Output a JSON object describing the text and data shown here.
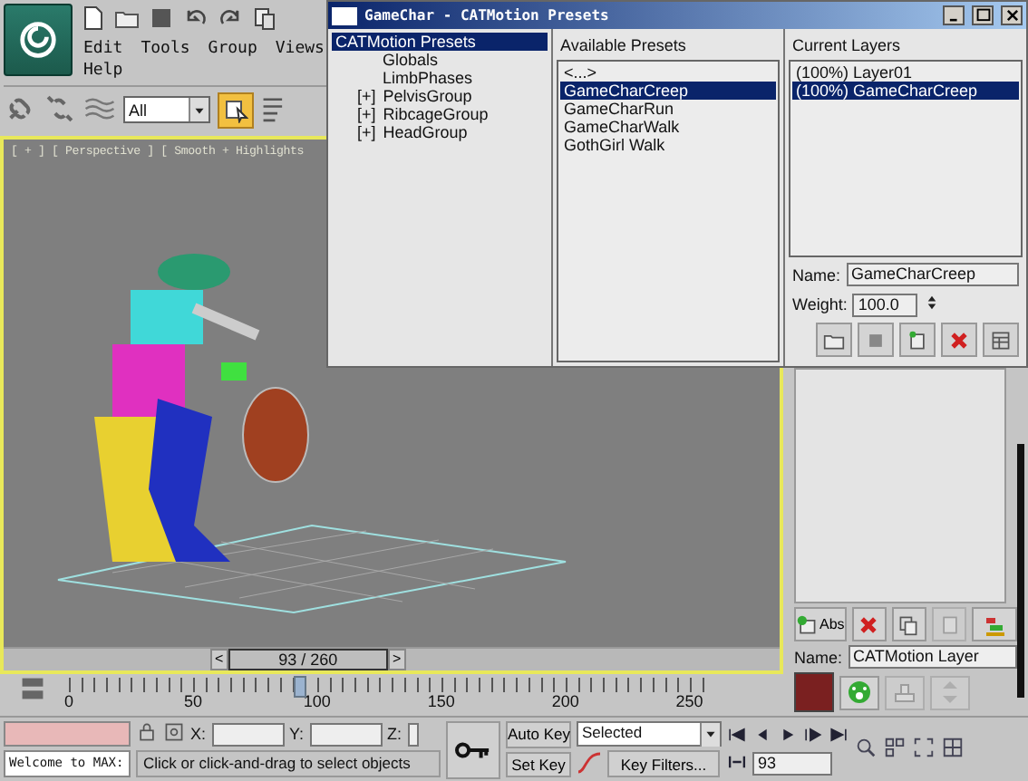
{
  "app": {
    "menus": [
      {
        "label": "Edit"
      },
      {
        "label": "Tools"
      },
      {
        "label": "Group"
      },
      {
        "label": "Views"
      },
      {
        "label": "Help"
      }
    ],
    "filter": "All"
  },
  "viewport": {
    "label": "[ + ] [ Perspective ] [ Smooth + Highlights"
  },
  "time_slider": {
    "prev": "<",
    "reading": "93 / 260",
    "next": ">",
    "level": 0.358
  },
  "track": {
    "ticks": [
      "0",
      "50",
      "100",
      "150",
      "200",
      "250"
    ]
  },
  "status": {
    "prompt": "Welcome to MAX:",
    "x_label": "X:",
    "y_label": "Y:",
    "z_label": "Z:",
    "message": "Click or click-and-drag to select objects",
    "auto_key": "Auto Key",
    "set_key": "Set Key",
    "key_mode": "Selected",
    "key_filters": "Key Filters...",
    "frame": "93"
  },
  "command_panel": {
    "abs": "Abs",
    "name_label": "Name:",
    "name_value": "CATMotion Layer"
  },
  "dialog": {
    "title": "GameChar - CATMotion Presets",
    "tree": [
      {
        "label": "CATMotion Presets",
        "selected": true,
        "children": [
          {
            "label": "Globals",
            "selected": false
          },
          {
            "label": "LimbPhases",
            "selected": false
          },
          {
            "label": "PelvisGroup",
            "selected": false,
            "toggle": "[+]"
          },
          {
            "label": "RibcageGroup",
            "selected": false,
            "toggle": "[+]"
          },
          {
            "label": "HeadGroup",
            "selected": false,
            "toggle": "[+]"
          }
        ]
      }
    ],
    "presets": {
      "heading": "Available Presets",
      "items": [
        {
          "label": "<...>",
          "selected": false
        },
        {
          "label": "GameCharCreep",
          "selected": true
        },
        {
          "label": "GameCharRun",
          "selected": false
        },
        {
          "label": "GameCharWalk",
          "selected": false
        },
        {
          "label": "GothGirl Walk",
          "selected": false
        }
      ]
    },
    "layers": {
      "heading": "Current Layers",
      "items": [
        {
          "label": "(100%) Layer01",
          "selected": false
        },
        {
          "label": "(100%) GameCharCreep",
          "selected": true
        }
      ]
    },
    "name_label": "Name:",
    "name_value": "GameCharCreep",
    "weight_label": "Weight:",
    "weight_value": "100.0"
  }
}
